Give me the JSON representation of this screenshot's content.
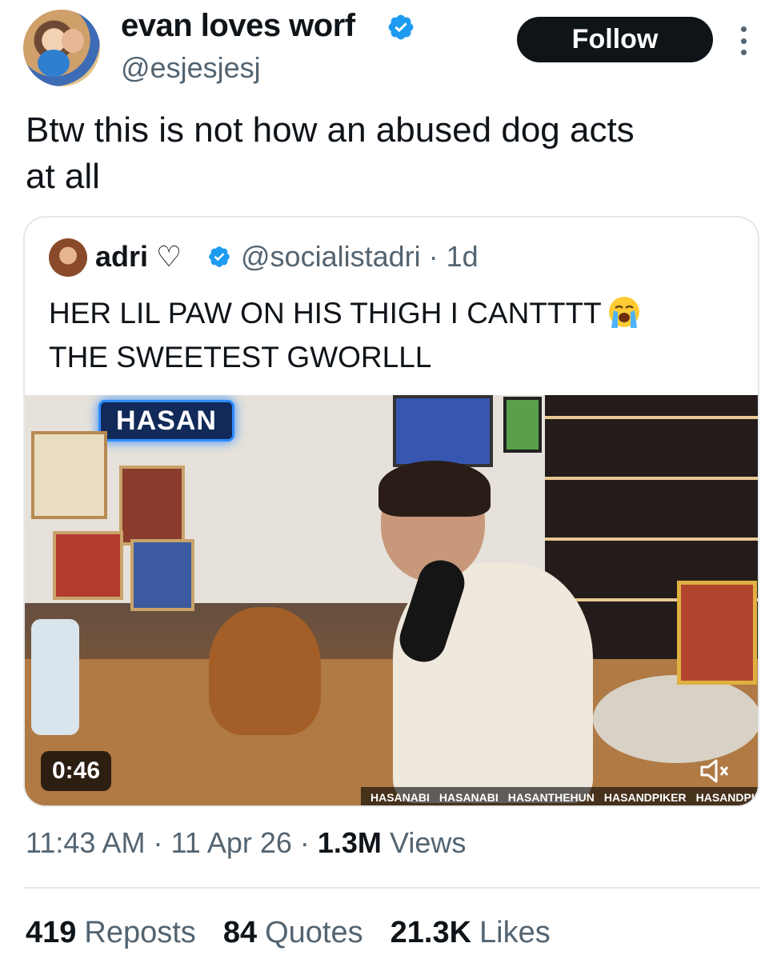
{
  "author": {
    "display_name": "evan loves worf",
    "handle": "@esjesjesj",
    "verified": true
  },
  "follow_label": "Follow",
  "tweet_text": "Btw this is not how an abused dog acts\nat all",
  "quoted": {
    "display_name": "adri ♡",
    "handle_time": "@socialistadri · 1d",
    "text": "HER LIL PAW ON HIS THIGH I CANTTTT",
    "text_line2": "THE SWEETEST GWORLLL",
    "emoji": "loudly-crying-face",
    "video": {
      "neon_sign": "HASAN",
      "duration": "0:46",
      "socials": [
        "HASANABI",
        "HASANABI",
        "HASANTHEHUN",
        "HASANDPIKER",
        "HASANDPIKER"
      ]
    }
  },
  "timestamp": {
    "time": "11:43 AM",
    "date": "11 Apr 26",
    "views_count": "1.3M",
    "views_label": "Views"
  },
  "stats": {
    "reposts_count": "419",
    "reposts_label": "Reposts",
    "quotes_count": "84",
    "quotes_label": "Quotes",
    "likes_count": "21.3K",
    "likes_label": "Likes"
  },
  "colors": {
    "text": "#0f1419",
    "secondary": "#536471",
    "verified": "#1d9bf0",
    "border": "#e4e8eb"
  }
}
